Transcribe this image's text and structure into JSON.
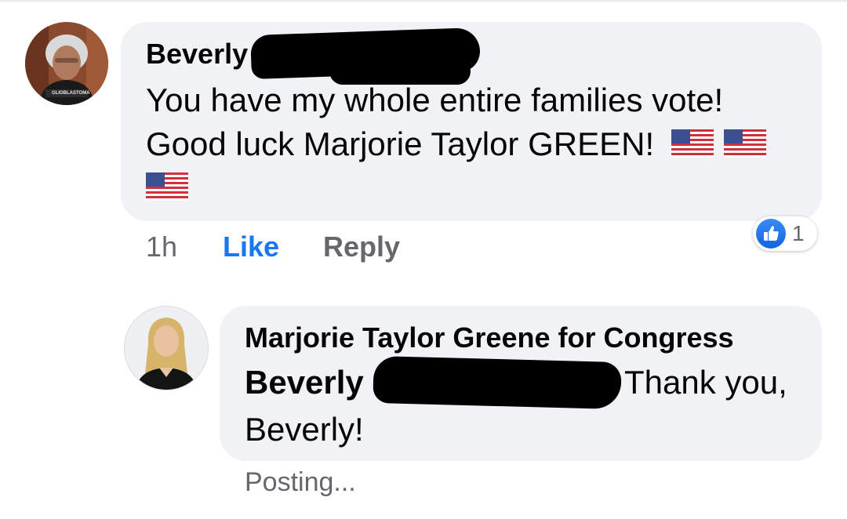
{
  "comment": {
    "author_first": "Beverly",
    "text_line1": "You have my whole entire families vote!",
    "text_line2": "Good luck Marjorie Taylor GREEN!",
    "flag_icon": "us-flag-emoji",
    "time": "1h",
    "like_label": "Like",
    "reply_label": "Reply",
    "reaction_count": "1",
    "reaction_icon": "thumbs-up-icon",
    "avatar_badge_text": "GLIOBLASTOMA",
    "colors": {
      "bubble": "#f0f2f5",
      "like_active": "#1877f2",
      "meta": "#65676b"
    }
  },
  "reply": {
    "author": "Marjorie Taylor Greene for Congress",
    "mention_first": "Beverly",
    "text_after_mention": "Thank you,",
    "text_line2": "Beverly!",
    "status": "Posting..."
  }
}
